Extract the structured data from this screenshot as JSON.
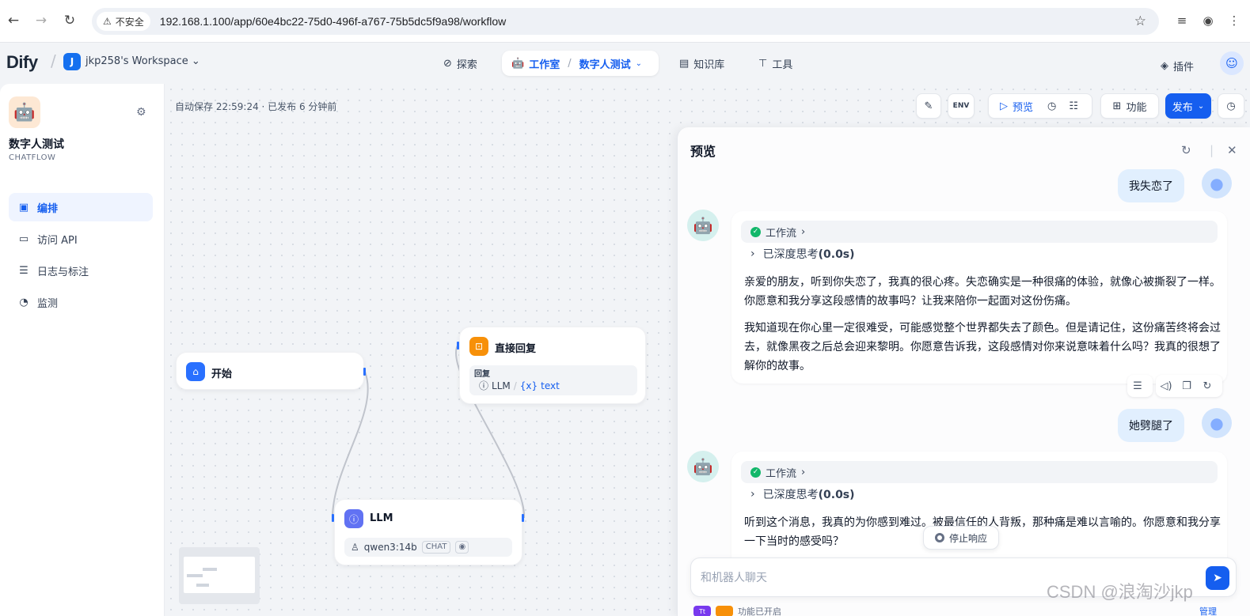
{
  "browser": {
    "security_label": "不安全",
    "url": "192.168.1.100/app/60e4bc22-75d0-496f-a767-75b5dc5f9a98/workflow"
  },
  "header": {
    "logo": "Dify",
    "workspace_initial": "J",
    "workspace_name": "jkp258's Workspace",
    "nav": {
      "explore": "探索",
      "studio": "工作室",
      "current_app": "数字人测试",
      "knowledge": "知识库",
      "tools": "工具",
      "plugins": "插件"
    }
  },
  "sidebar": {
    "app_name": "数字人测试",
    "app_type": "CHATFLOW",
    "items": [
      {
        "label": "编排",
        "icon": "layout-icon"
      },
      {
        "label": "访问 API",
        "icon": "terminal-icon"
      },
      {
        "label": "日志与标注",
        "icon": "log-icon"
      },
      {
        "label": "监测",
        "icon": "monitor-icon"
      }
    ]
  },
  "canvas": {
    "autosave": "自动保存 22:59:24 · 已发布 6 分钟前",
    "toolbar": {
      "preview": "预览",
      "features": "功能",
      "publish": "发布",
      "env": "ENV"
    },
    "nodes": {
      "start": {
        "title": "开始"
      },
      "reply": {
        "title": "直接回复",
        "field_label": "回复",
        "var_source": "LLM",
        "var_name": "text",
        "var_prefix": "{x}"
      },
      "llm": {
        "title": "LLM",
        "model": "qwen3:14b",
        "mode": "CHAT"
      }
    }
  },
  "preview": {
    "title": "预览",
    "messages": [
      {
        "role": "user",
        "text": "我失恋了"
      },
      {
        "role": "bot",
        "workflow_label": "工作流",
        "think_label": "已深度思考",
        "think_time": "(0.0s)",
        "paragraphs": [
          "亲爱的朋友，听到你失恋了，我真的很心疼。失恋确实是一种很痛的体验，就像心被撕裂了一样。你愿意和我分享这段感情的故事吗？让我来陪你一起面对这份伤痛。",
          "我知道现在你心里一定很难受，可能感觉整个世界都失去了颜色。但是请记住，这份痛苦终将会过去，就像黑夜之后总会迎来黎明。你愿意告诉我，这段感情对你来说意味着什么吗？我真的很想了解你的故事。"
        ]
      },
      {
        "role": "user",
        "text": "她劈腿了"
      },
      {
        "role": "bot",
        "workflow_label": "工作流",
        "think_label": "已深度思考",
        "think_time": "(0.0s)",
        "paragraphs": [
          "听到这个消息，我真的为你感到难过。被最信任的人背叛，那种痛是难以言喻的。你愿意和我分享一下当时的感受吗？"
        ]
      }
    ],
    "stop_label": "停止响应",
    "input_placeholder": "和机器人聊天",
    "bottom_text": "功能已开启",
    "manage_link": "管理"
  },
  "watermark": "CSDN @浪淘沙jkp",
  "colors": {
    "primary": "#155eef",
    "start_node": "#2970ff",
    "reply_node": "#f79009",
    "llm_node": "#6172f3",
    "user_bubble": "#e1effe"
  }
}
